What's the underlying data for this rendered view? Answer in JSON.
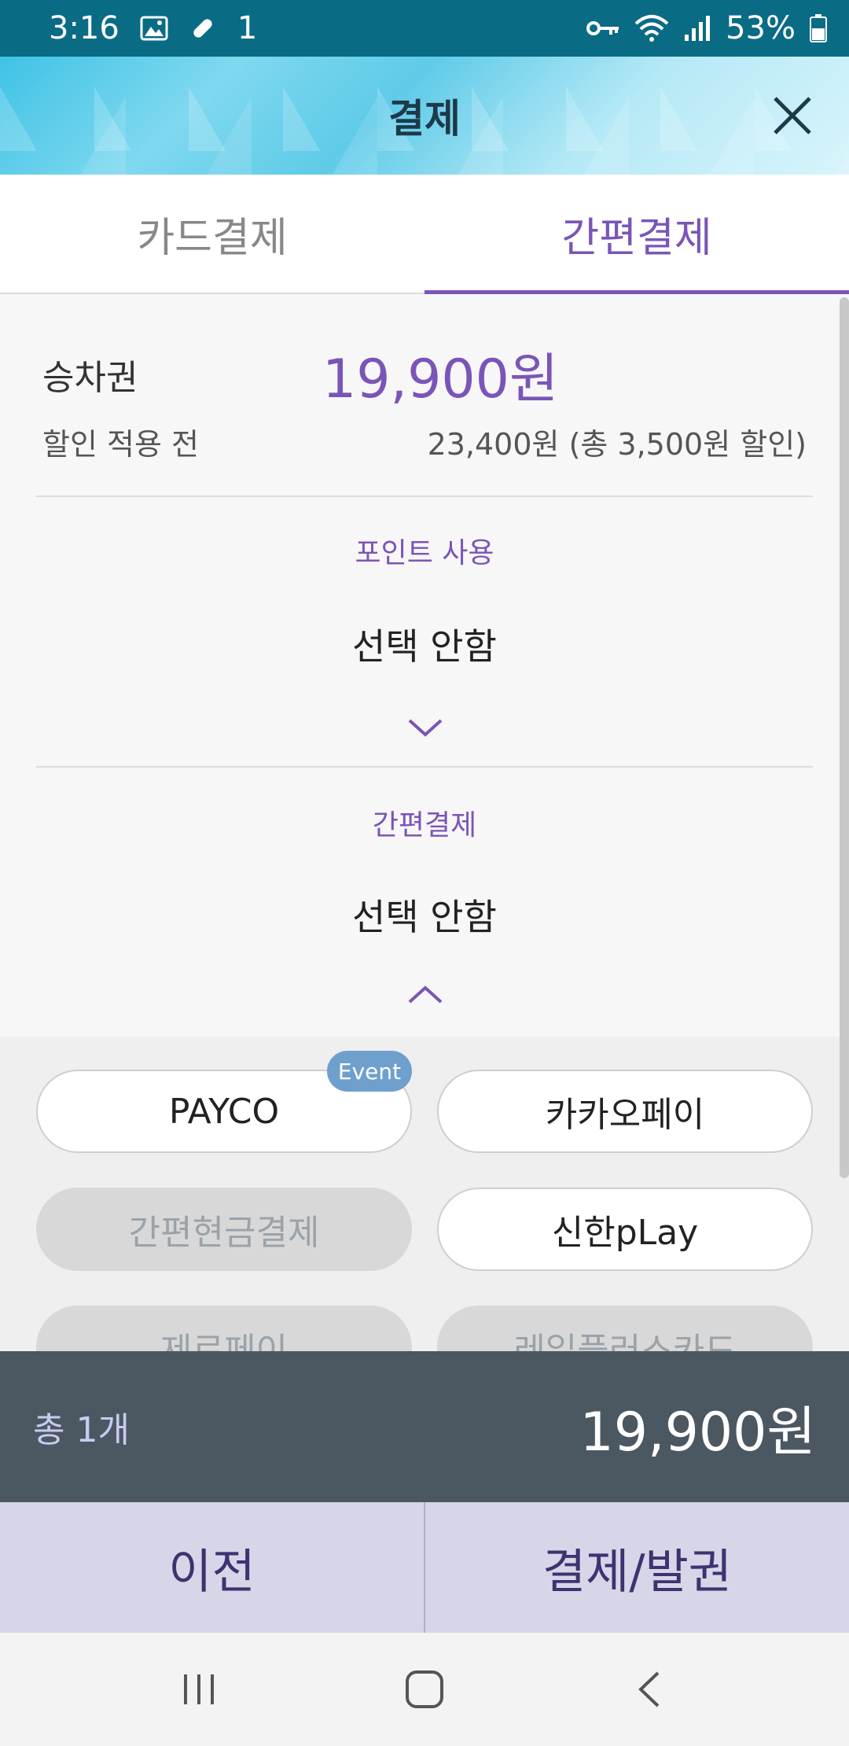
{
  "status_bar": {
    "time": "3:16",
    "notif_extra": "1",
    "battery": "53%"
  },
  "header": {
    "title": "결제"
  },
  "tabs": [
    {
      "label": "카드결제",
      "active": false
    },
    {
      "label": "간편결제",
      "active": true
    }
  ],
  "summary": {
    "ticket_label": "승차권",
    "ticket_price": "19,900원",
    "before_discount_label": "할인 적용 전",
    "before_discount_value": "23,400원 (총 3,500원 할인)"
  },
  "points": {
    "label": "포인트 사용",
    "value": "선택 안함"
  },
  "easy_pay": {
    "label": "간편결제",
    "value": "선택 안함"
  },
  "pay_options": [
    {
      "label": "PAYCO",
      "enabled": true,
      "badge": "Event"
    },
    {
      "label": "카카오페이",
      "enabled": true
    },
    {
      "label": "간편현금결제",
      "enabled": false
    },
    {
      "label": "신한pLay",
      "enabled": true
    },
    {
      "label": "제로페이",
      "enabled": false
    },
    {
      "label": "레일플러스카드",
      "enabled": false
    }
  ],
  "total": {
    "count": "총 1개",
    "amount": "19,900원"
  },
  "actions": {
    "prev": "이전",
    "pay": "결제/발권"
  },
  "colors": {
    "accent": "#7a55b8",
    "status_bar": "#0a6b85",
    "total_bar": "#4b5862",
    "action_bar": "#d6d6e8"
  }
}
